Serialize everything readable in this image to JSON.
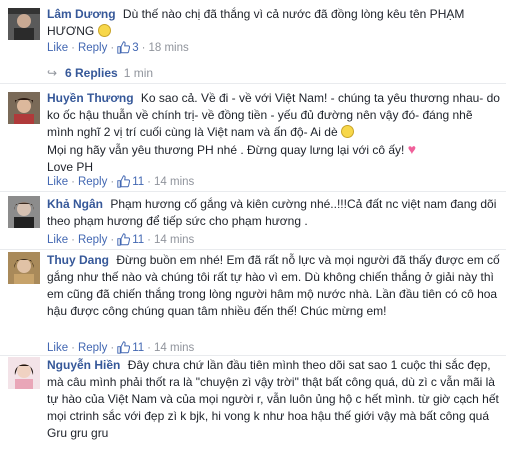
{
  "comments": [
    {
      "author": "Lâm Dương",
      "text": "Dù thế nào chị đã thắng vì cả nước đã đồng lòng kêu tên PHẠM HƯƠNG",
      "emoji": "smile-emoji",
      "like_label": "Like",
      "reply_label": "Reply",
      "likes": "3",
      "time": "18 mins",
      "replies_label": "6 Replies",
      "replies_time": "1 min"
    },
    {
      "author": "Huyền Thương",
      "text": "Ko sao cả. Về đi - về với Việt Nam! - chúng ta yêu thương nhau- do ko ốc hậu thuẫn về chính trị- về đồng tiền - yếu đủ đường nên vậy đó- đáng nhẽ mình nghĩ 2 vị trí cuối cùng là Việt nam và ấn độ- Ai dè",
      "line2": "Mọi ng hãy vẫn yêu thương PH nhé . Đừng quay lưng lại với cô ấy!",
      "line3": "Love PH",
      "emoji1": "crying-emoji",
      "emoji2": "heart-emoji",
      "like_label": "Like",
      "reply_label": "Reply",
      "likes": "11",
      "time": "14 mins"
    },
    {
      "author": "Khả Ngân",
      "text": "Phạm hương cố gắng và kiên cường nhé..!!!Cả đất nc việt nam đang dõi theo phạm hương để tiếp sức cho phạm hương .",
      "like_label": "Like",
      "reply_label": "Reply",
      "likes": "11",
      "time": "14 mins"
    },
    {
      "author": "Thuy Dang",
      "text": "Đừng buồn em nhé! Em đã rất nỗ lực và mọi người đã thấy được em cố gắng như thế nào và chúng tôi rất tự hào vì em. Dù không chiến thắng ở giải này thì em cũng đã chiến thắng trong lòng người hâm mộ nước nhà. Lần đầu tiên có cô hoa hậu được công chúng quan tâm nhiều đến thế! Chúc mừng em!",
      "like_label": "Like",
      "reply_label": "Reply",
      "likes": "11",
      "time": "14 mins"
    },
    {
      "author": "Nguyễn Hiền",
      "text": "Đây chưa chứ lần đầu tiên mình theo dõi sat sao 1 cuộc thi sắc đẹp, mà câu mình phải thốt ra là \"chuyện zì vậy trời\" thật bất công quá, dù zì c vẫn mãi là tự hào của Việt Nam và của mọi người r, vẫn luôn ủng hộ c hết mình. từ giờ cạch hết mọi ctrinh sắc với đẹp zì k bjk, hi vong k như hoa hậu thế giới vậy mà bất công quá Gru gru gru"
    }
  ]
}
